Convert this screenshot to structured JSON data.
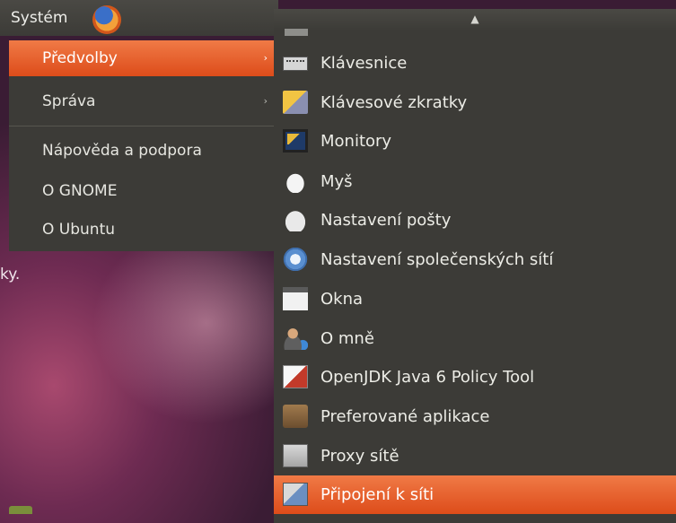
{
  "top_panel": {
    "label": "Systém",
    "icon": "firefox-icon"
  },
  "system_menu": {
    "items": [
      {
        "label": "Předvolby",
        "submenu": true,
        "active": true
      },
      {
        "label": "Správa",
        "submenu": true,
        "active": false
      },
      {
        "label": "Nápověda a podpora",
        "submenu": false,
        "active": false
      },
      {
        "label": "O GNOME",
        "submenu": false,
        "active": false
      },
      {
        "label": "O Ubuntu",
        "submenu": false,
        "active": false
      }
    ],
    "submenu_arrow": "›"
  },
  "desktop": {
    "text": "ky."
  },
  "preferences_submenu": {
    "scroll_up": "▲",
    "items": [
      {
        "label": "Klávesnice",
        "icon": "keyboard-icon"
      },
      {
        "label": "Klávesové zkratky",
        "icon": "keyboard-shortcuts-icon"
      },
      {
        "label": "Monitory",
        "icon": "monitor-icon"
      },
      {
        "label": "Myš",
        "icon": "mouse-icon"
      },
      {
        "label": "Nastavení pošty",
        "icon": "mail-icon"
      },
      {
        "label": "Nastavení společenských sítí",
        "icon": "social-network-icon"
      },
      {
        "label": "Okna",
        "icon": "windows-icon"
      },
      {
        "label": "O mně",
        "icon": "about-me-icon"
      },
      {
        "label": "OpenJDK Java 6 Policy Tool",
        "icon": "java-policy-icon"
      },
      {
        "label": "Preferované aplikace",
        "icon": "preferred-apps-icon"
      },
      {
        "label": "Proxy sítě",
        "icon": "proxy-icon"
      },
      {
        "label": "Připojení k síti",
        "icon": "network-connections-icon",
        "active": true
      }
    ]
  },
  "colors": {
    "menu_bg": "#3c3b37",
    "highlight": "#e8612b",
    "text": "#e6e6e0"
  }
}
